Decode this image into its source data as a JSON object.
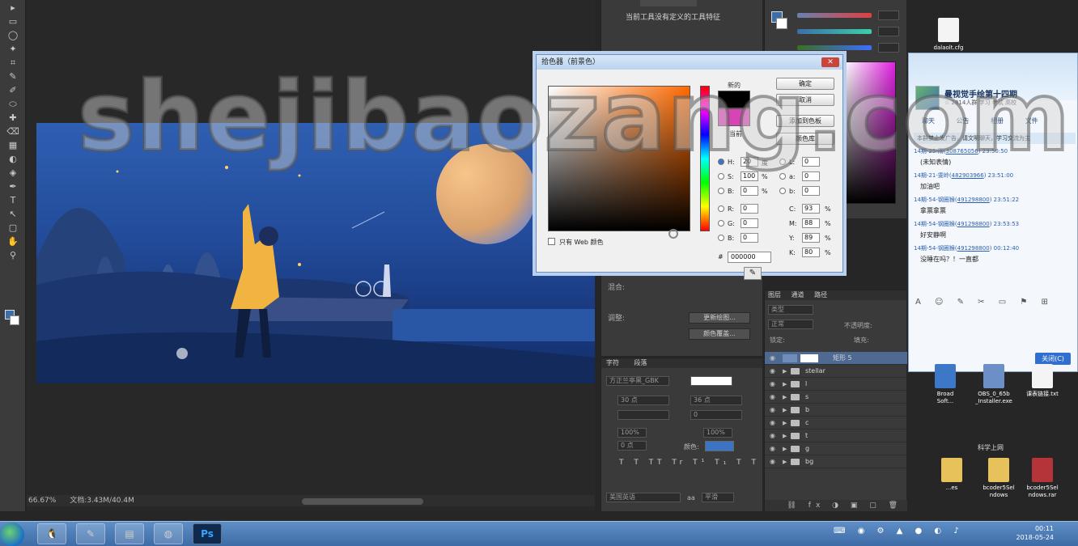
{
  "watermark": "shejibaozang.com",
  "toolbar": {
    "tools": [
      "▸",
      "▭",
      "◯",
      "✦",
      "⌗",
      "✎",
      "✐",
      "⬭",
      "✚",
      "⌫",
      "▦",
      "◐",
      "◈",
      "✒",
      "T",
      "↖",
      "▢",
      "✋",
      "⚲"
    ]
  },
  "document": {
    "zoom": "66.67%",
    "doc_info": "文档:3.43M/40.4M"
  },
  "properties_panel": {
    "hint": "当前工具没有定义的工具特征",
    "blend_label": "混合:",
    "adjust_label": "调整:",
    "buttons": [
      "更新绘图...",
      "颜色覆盖..."
    ]
  },
  "color_picker": {
    "title": "拾色器（前景色）",
    "close": "✕",
    "new_label": "新的",
    "current_label": "当前",
    "ok": "确定",
    "cancel": "取消",
    "add_swatch": "添加到色板",
    "color_libraries": "颜色库",
    "web_only": "只有 Web 颜色",
    "h_label": "H:",
    "h_value": "20",
    "h_unit": "度",
    "s_label": "S:",
    "s_value": "100",
    "s_unit": "%",
    "b_label": "B:",
    "b_value": "0",
    "b_unit": "%",
    "r_label": "R:",
    "r_value": "0",
    "g_label": "G:",
    "g_value": "0",
    "bb_label": "B:",
    "bb_value": "0",
    "l_label": "L:",
    "l_value": "0",
    "a_label": "a:",
    "a_value": "0",
    "lb_label": "b:",
    "lb_value": "0",
    "c_label": "C:",
    "c_value": "93",
    "c_unit": "%",
    "m_label": "M:",
    "m_value": "88",
    "m_unit": "%",
    "y_label": "Y:",
    "y_value": "89",
    "y_unit": "%",
    "k_label": "K:",
    "k_value": "80",
    "k_unit": "%",
    "hex_label": "#",
    "hex_value": "000000"
  },
  "layers": {
    "tabs": [
      "图层",
      "通道",
      "路径"
    ],
    "kind": "类型",
    "blend": "正常",
    "opacity_label": "不透明度:",
    "lock_label": "锁定:",
    "fill_label": "填充:",
    "items": [
      {
        "name": "矩形 5",
        "type": "shape",
        "selected": true
      },
      {
        "name": "stellar",
        "type": "folder"
      },
      {
        "name": "l",
        "type": "folder"
      },
      {
        "name": "s",
        "type": "folder"
      },
      {
        "name": "b",
        "type": "folder"
      },
      {
        "name": "c",
        "type": "folder"
      },
      {
        "name": "t",
        "type": "folder"
      },
      {
        "name": "g",
        "type": "folder"
      },
      {
        "name": "bg",
        "type": "folder"
      }
    ]
  },
  "character": {
    "tabs": [
      "字符",
      "段落"
    ],
    "font": "方正兰亭黑_GBK",
    "size": "30 点",
    "leading": "36 点",
    "tracking": "0",
    "scale_v": "100%",
    "scale_h": "100%",
    "baseline": "0 点",
    "color_label": "颜色:",
    "language": "美国英语",
    "aa_label": "aa",
    "aa_value": "平滑"
  },
  "qq": {
    "group_name": "曼视觉手绘第十四期",
    "group_sub": "☆ 2814人群 学习 考试 高校",
    "toolbar": [
      "聊天",
      "公告",
      "相册",
      "文件"
    ],
    "notice": "本群禁止发广告，请文明聊天，学习交流为主",
    "messages": [
      {
        "time": "14期-25-雨(",
        "qq": "308765056",
        "clock": "23:50:50",
        "text": "(未知表情)"
      },
      {
        "time": "14期-21-雯岭(",
        "qq": "482903966",
        "clock": "23:51:00",
        "text": "加油吧"
      },
      {
        "time": "14期-54-钢圈猴(",
        "qq": "491298800",
        "clock": "23:51:22",
        "text": "拿票拿票"
      },
      {
        "time": "14期-54-钢圈猴(",
        "qq": "491298800",
        "clock": "23:53:53",
        "text": "好安静啊"
      },
      {
        "time": "14期-54-钢圈猴(",
        "qq": "491298800",
        "clock": "00:12:40",
        "text": "没睡在吗？！一直都"
      }
    ],
    "tools": "A ☺ ✎ ✂ ▭ ⚑ ⊞",
    "send": "关闭(C)"
  },
  "desktop": {
    "top_icon": "dalaolt.cfg",
    "icons": [
      {
        "label": "Broad\nSoft...",
        "color": "#3d78c8"
      },
      {
        "label": "OBS_0_65b\n_Installer.exe",
        "color": "#6b8fc6"
      },
      {
        "label": "课表链接.txt",
        "color": "#f4f4f4"
      },
      {
        "label": "...es",
        "color": "#e7c25a"
      },
      {
        "label": "bcoder5Sel\nndows",
        "color": "#e7c25a"
      },
      {
        "label": "bcoder5Sel\nndows.rar",
        "color": "#b5343a"
      }
    ],
    "group_label": "科学上网"
  },
  "taskbar": {
    "apps": [
      "🐧",
      "✎",
      "▤",
      "◍",
      "Ps"
    ],
    "clock_time": "00:11",
    "clock_date": "2018-05-24"
  }
}
